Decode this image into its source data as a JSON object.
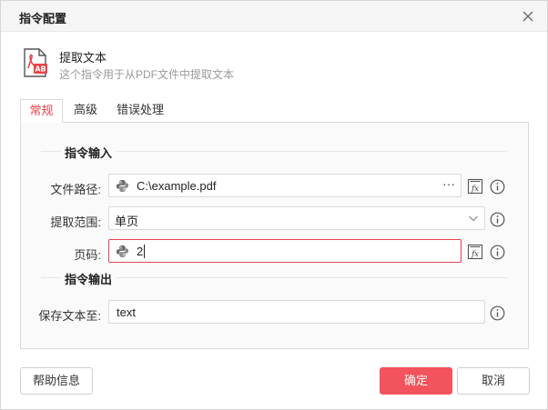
{
  "dialog": {
    "title": "指令配置"
  },
  "command": {
    "name": "提取文本",
    "description": "这个指令用于从PDF文件中提取文本",
    "icon": "pdf-ab-icon"
  },
  "tabs": [
    {
      "label": "常规",
      "active": true
    },
    {
      "label": "高级",
      "active": false
    },
    {
      "label": "错误处理",
      "active": false
    }
  ],
  "sections": {
    "input": "指令输入",
    "output": "指令输出"
  },
  "fields": {
    "file_path": {
      "label": "文件路径:",
      "value": "C:\\example.pdf",
      "more": "···"
    },
    "extract_range": {
      "label": "提取范围:",
      "value": "单页"
    },
    "page_num": {
      "label": "页码:",
      "value": "2"
    },
    "save_to": {
      "label": "保存文本至:",
      "value": "text"
    }
  },
  "buttons": {
    "help": "帮助信息",
    "ok": "确定",
    "cancel": "取消"
  },
  "colors": {
    "accent": "#e8434a",
    "primary_button": "#f2535c"
  }
}
